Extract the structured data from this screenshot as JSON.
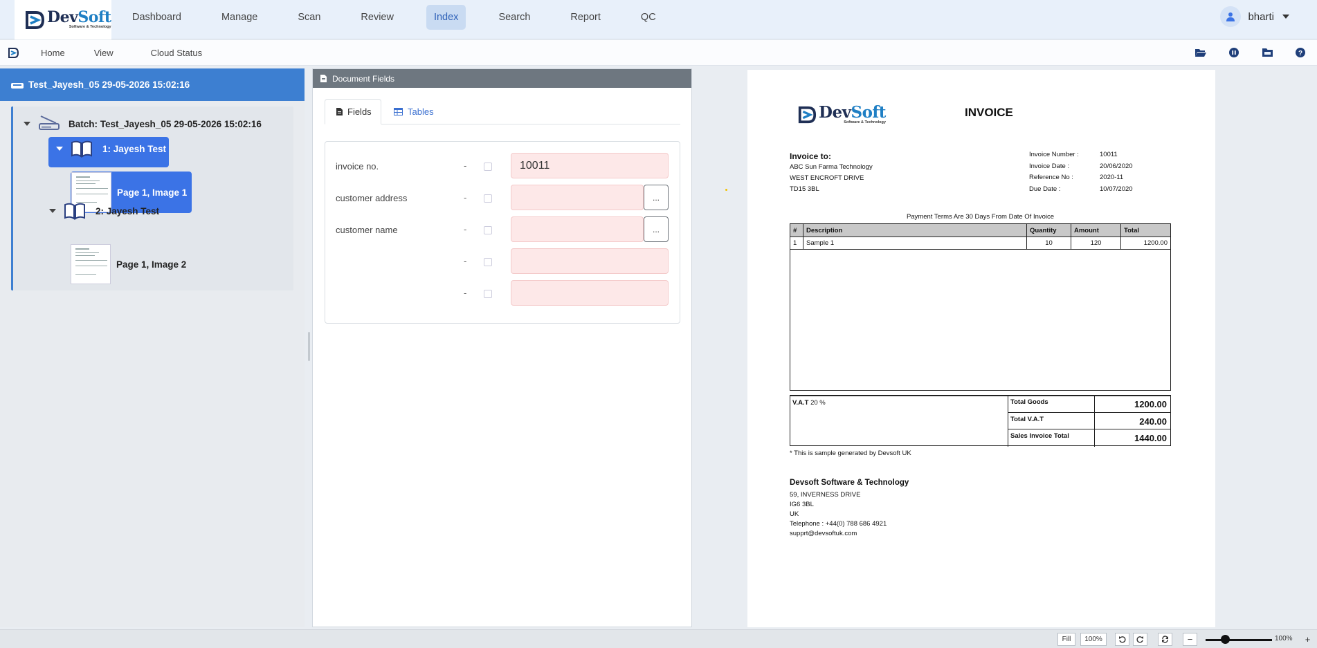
{
  "app": {
    "logo_main": "Dev",
    "logo_soft": "Soft",
    "logo_tagline": "Software & Technology",
    "colors": {
      "primary": "#3b73e6",
      "header_blue": "#3d7fd1",
      "field_bg": "#fde8e8",
      "nav_active": "#c9dbf2"
    }
  },
  "nav": {
    "items": [
      "Dashboard",
      "Manage",
      "Scan",
      "Review",
      "Index",
      "Search",
      "Report",
      "QC"
    ],
    "active": "Index",
    "user": "bharti"
  },
  "subnav": {
    "items": [
      "Home",
      "View",
      "Cloud Status"
    ],
    "icons": [
      "folder-open-icon",
      "pause-icon",
      "folder-icon",
      "help-icon"
    ]
  },
  "tree": {
    "header": "Test_Jayesh_05 29-05-2026 15:02:16",
    "batch": "Batch: Test_Jayesh_05 29-05-2026 15:02:16",
    "documents": [
      {
        "label": "1: Jayesh Test",
        "pages": [
          "Page 1, Image 1"
        ],
        "selected": true
      },
      {
        "label": "2: Jayesh Test",
        "pages": [
          "Page 1, Image 2"
        ],
        "selected": false
      }
    ]
  },
  "fields_panel": {
    "header": "Document Fields",
    "tabs": [
      "Fields",
      "Tables"
    ],
    "fields": [
      {
        "label": "invoice no.",
        "dash": "-",
        "value": "10011",
        "has_button": false
      },
      {
        "label": "customer address",
        "dash": "-",
        "value": "",
        "has_button": true,
        "button_label": "..."
      },
      {
        "label": "customer name",
        "dash": "-",
        "value": "",
        "has_button": true,
        "button_label": "..."
      },
      {
        "label": "",
        "dash": "-",
        "value": "",
        "has_button": false
      },
      {
        "label": "",
        "dash": "-",
        "value": "",
        "has_button": false
      }
    ]
  },
  "invoice": {
    "title": "INVOICE",
    "to_heading": "Invoice to:",
    "to_lines": [
      "ABC Sun Farma Technology",
      "WEST ENCROFT DRIVE",
      "TD15 3BL"
    ],
    "meta": [
      {
        "key": "Invoice Number :",
        "value": "10011"
      },
      {
        "key": "Invoice Date :",
        "value": "20/06/2020"
      },
      {
        "key": "Reference No :",
        "value": "2020-11"
      },
      {
        "key": "Due Date :",
        "value": "10/07/2020"
      }
    ],
    "terms": "Payment Terms Are 30 Days From Date Of Invoice",
    "table_headers": [
      "#",
      "Description",
      "Quantity",
      "Amount",
      "Total"
    ],
    "rows": [
      {
        "no": "1",
        "description": "Sample 1",
        "quantity": "10",
        "amount": "120",
        "total": "1200.00"
      }
    ],
    "vat_label": "V.A.T",
    "vat_rate": "20 %",
    "totals": [
      {
        "key": "Total Goods",
        "value": "1200.00"
      },
      {
        "key": "Total V.A.T",
        "value": "240.00"
      },
      {
        "key": "Sales Invoice Total",
        "value": "1440.00"
      }
    ],
    "note": "* This is sample generated by Devsoft UK",
    "from_heading": "Devsoft Software & Technology",
    "from_lines": [
      "59, INVERNESS DRIVE",
      "IG6 3BL",
      "UK",
      "Telephone : +44(0) 788 686 4921",
      "supprt@devsoftuk.com"
    ]
  },
  "statusbar": {
    "fill_label": "Fill",
    "zoom_box": "100%",
    "zoom_out": "−",
    "zoom_in": "+",
    "zoom_level": "100%",
    "zoom_fraction": 0.3
  }
}
